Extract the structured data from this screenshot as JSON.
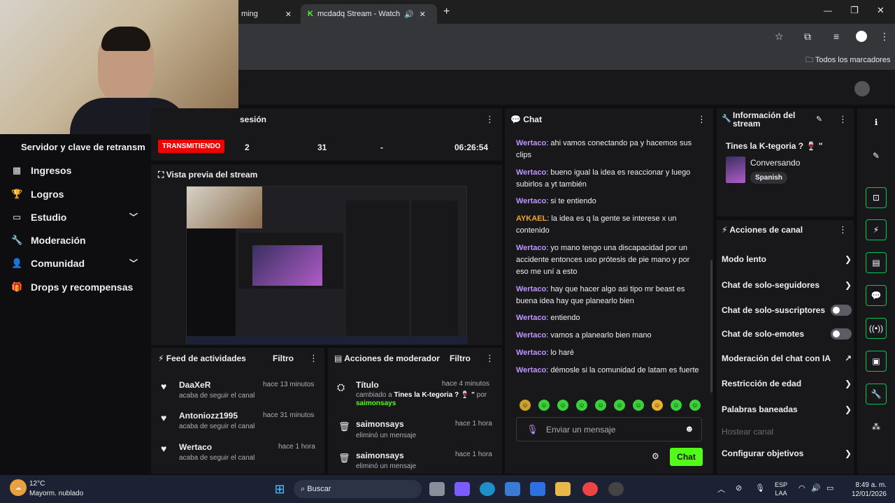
{
  "browser": {
    "tab1_label": "ming",
    "tab2_label": "mcdadq Stream - Watch Li",
    "bookmarks_label": "Todos los marcadores"
  },
  "stats_header": {
    "title": "sesión",
    "status_badge": "TRANSMITIENDO",
    "viewers": "2",
    "followers": "31",
    "subs": "-",
    "uptime": "06:26:54"
  },
  "sidebar": {
    "server_label": "Servidor y clave de retransm",
    "items": [
      {
        "label": "Ingresos",
        "icon": "revenue-icon"
      },
      {
        "label": "Logros",
        "icon": "trophy-icon"
      },
      {
        "label": "Estudio",
        "icon": "studio-icon"
      },
      {
        "label": "Moderación",
        "icon": "wrench-icon"
      },
      {
        "label": "Comunidad",
        "icon": "community-icon"
      },
      {
        "label": "Drops y recompensas",
        "icon": "drops-icon"
      }
    ]
  },
  "preview": {
    "title": "Vista previa del stream"
  },
  "activity": {
    "title": "Feed de actividades",
    "filter": "Filtro",
    "items": [
      {
        "user": "DaaXeR",
        "time": "hace 13 minutos",
        "text": "acaba de seguir el canal"
      },
      {
        "user": "Antoniozz1995",
        "time": "hace 31 minutos",
        "text": "acaba de seguir el canal"
      },
      {
        "user": "Wertaco",
        "time": "hace 1 hora",
        "text": "acaba de seguir el canal"
      }
    ]
  },
  "modactions": {
    "title": "Acciones de moderador",
    "filter": "Filtro",
    "items": [
      {
        "title": "Título",
        "time": "hace 4 minutos",
        "text": "cambiado a",
        "highlight": "Tines la K-tegoria ? 🍷 \"",
        "suffix": "por",
        "by": "saimonsays"
      },
      {
        "title": "saimonsays",
        "time": "hace 1 hora",
        "text": "eliminó un mensaje"
      },
      {
        "title": "saimonsays",
        "time": "hace 1 hora",
        "text": "eliminó un mensaje"
      }
    ]
  },
  "chat": {
    "title": "Chat",
    "messages": [
      {
        "user": "Wertaco",
        "text": "ahi vamos conectando pa y hacemos sus clips"
      },
      {
        "user": "Wertaco",
        "text": "bueno igual la idea es reaccionar y luego subirlos a yt también"
      },
      {
        "user": "Wertaco",
        "text": "si te entiendo"
      },
      {
        "user": "AYKAEL",
        "text": "la idea es q la gente se interese x un contenido"
      },
      {
        "user": "Wertaco",
        "text": "yo mano tengo una discapacidad por un accidente entonces uso prótesis de pie mano y por eso me uní a esto"
      },
      {
        "user": "Wertaco",
        "text": "hay que hacer algo asi tipo mr beast es buena idea hay que planearlo bien"
      },
      {
        "user": "Wertaco",
        "text": "entiendo"
      },
      {
        "user": "Wertaco",
        "text": "vamos a planearlo bien mano"
      },
      {
        "user": "Wertaco",
        "text": "lo haré"
      },
      {
        "user": "Wertaco",
        "text": "démosle si la comunidad de latam es fuerte"
      }
    ],
    "placeholder": "Enviar un mensaje",
    "send": "Chat"
  },
  "streaminfo": {
    "title": "Información del stream",
    "stream_title": "Tines la K-tegoria ? 🍷 \"",
    "category": "Conversando",
    "tag": "Spanish"
  },
  "channel_actions": {
    "title": "Acciones de canal",
    "items": [
      {
        "label": "Modo lento",
        "kind": "arrow"
      },
      {
        "label": "Chat de solo-seguidores",
        "kind": "arrow"
      },
      {
        "label": "Chat de solo-suscriptores",
        "kind": "toggle"
      },
      {
        "label": "Chat de solo-emotes",
        "kind": "toggle"
      },
      {
        "label": "Moderación del chat con IA",
        "kind": "external"
      },
      {
        "label": "Restricción de edad",
        "kind": "arrow"
      },
      {
        "label": "Palabras baneadas",
        "kind": "arrow"
      },
      {
        "label": "Hostear canal",
        "kind": "disabled"
      },
      {
        "label": "Configurar objetivos",
        "kind": "arrow"
      }
    ]
  },
  "taskbar": {
    "temp": "12°C",
    "weather": "Mayorm. nublado",
    "search": "Buscar",
    "lang1": "ESP",
    "lang2": "LAA",
    "time": "8:49 a. m.",
    "date": "12/01/2026"
  },
  "colors": {
    "accent": "#53fc18",
    "live": "#eb0400",
    "username": "#bf94ff"
  }
}
